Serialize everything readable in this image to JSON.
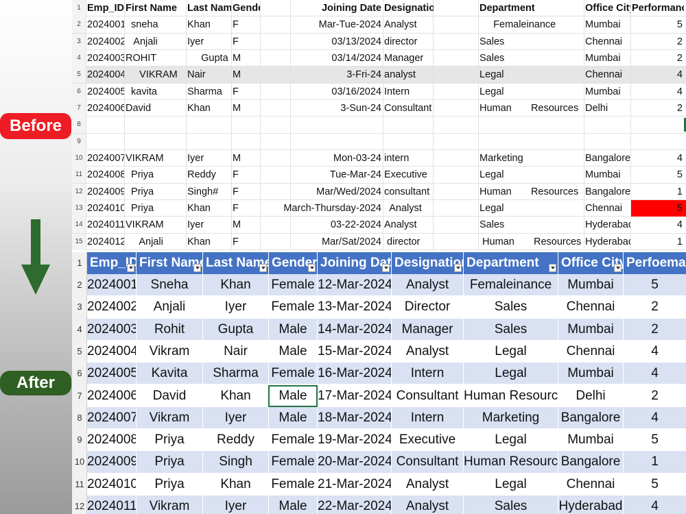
{
  "labels": {
    "before": "Before",
    "after": "After"
  },
  "colors": {
    "before_badge": "#ee1c25",
    "after_badge": "#2f5f22",
    "table_header": "#4472c4",
    "band": "#d9e1f2",
    "highlight_cell": "#ff0000"
  },
  "icons": {
    "arrow": "arrow-down-icon",
    "filter": "filter-dropdown-icon"
  },
  "before": {
    "headers": [
      "Emp_ID",
      "First Name",
      "Last Name",
      "Gender",
      "Joining Date",
      "Designation",
      "Department",
      "Office City",
      "Performance"
    ],
    "rows": [
      {
        "n": "2",
        "c": [
          "2024001",
          "  sneha",
          "Khan",
          "F",
          "Mar-Tue-2024",
          "Analyst",
          "     Femaleinance",
          "Mumbai",
          "5"
        ]
      },
      {
        "n": "3",
        "c": [
          "2024002",
          "   Anjali",
          "Iyer",
          "F",
          "03/13/2024",
          "director",
          "Sales",
          "Chennai",
          "2"
        ]
      },
      {
        "n": "4",
        "c": [
          "2024003",
          "ROHIT",
          "     Gupta",
          "M",
          "03/14/2024",
          "Manager",
          "Sales",
          "Mumbai",
          "2"
        ]
      },
      {
        "n": "5",
        "c": [
          "2024004",
          "     VIKRAM",
          "Nair",
          "M",
          "3-Fri-24",
          "analyst",
          "Legal",
          "Chennai",
          "4"
        ]
      },
      {
        "n": "6",
        "c": [
          "2024005",
          "  kavita",
          "Sharma",
          "F",
          "03/16/2024",
          "Intern",
          "Legal",
          "Mumbai",
          "4"
        ]
      },
      {
        "n": "7",
        "c": [
          "2024006",
          "David",
          "Khan",
          "M",
          "3-Sun-24",
          "Consultant",
          "Human       Resources",
          "Delhi",
          "2"
        ]
      },
      {
        "n": "8",
        "c": [
          "",
          "",
          "",
          "",
          "",
          "",
          "",
          "",
          ""
        ]
      },
      {
        "n": "9",
        "c": [
          "",
          "",
          "",
          "",
          "",
          "",
          "",
          "",
          ""
        ]
      },
      {
        "n": "10",
        "c": [
          "2024007",
          "VIKRAM",
          "Iyer",
          "M",
          "Mon-03-24",
          "intern",
          "Marketing",
          "Bangalore",
          "4"
        ]
      },
      {
        "n": "11",
        "c": [
          "2024008",
          "  Priya",
          "Reddy",
          "F",
          "Tue-Mar-24",
          "Executive",
          "Legal",
          "Mumbai",
          "5"
        ]
      },
      {
        "n": "12",
        "c": [
          "2024009",
          "  Priya",
          "Singh#",
          "F",
          "Mar/Wed/2024",
          "consultant",
          "Human       Resources",
          "Bangalore",
          "1"
        ]
      },
      {
        "n": "13",
        "c": [
          "2024010",
          "  Priya",
          "Khan",
          "F",
          "March-Thursday-2024",
          "  Analyst",
          "Legal",
          "Chennai",
          "5"
        ]
      },
      {
        "n": "14",
        "c": [
          "2024011",
          "VIKRAM",
          "Iyer",
          "M",
          "03-22-2024",
          "Analyst",
          "Sales",
          "Hyderabad",
          "4"
        ]
      },
      {
        "n": "15",
        "c": [
          "2024012",
          "     Anjali",
          "Khan",
          "F",
          "Mar/Sat/2024",
          " director",
          " Human       Resources",
          "Hyderabad",
          "1"
        ]
      }
    ]
  },
  "after": {
    "headers": [
      "Emp_ID",
      "First Name",
      "Last Name",
      "Gender",
      "Joining Date",
      "Designation",
      "Department",
      "Office City",
      "Perfoemance"
    ],
    "rows": [
      {
        "n": "2",
        "c": [
          "2024001",
          "Sneha",
          "Khan",
          "Female",
          "12-Mar-2024",
          "Analyst",
          "Femaleinance",
          "Mumbai",
          "5"
        ]
      },
      {
        "n": "3",
        "c": [
          "2024002",
          "Anjali",
          "Iyer",
          "Female",
          "13-Mar-2024",
          "Director",
          "Sales",
          "Chennai",
          "2"
        ]
      },
      {
        "n": "4",
        "c": [
          "2024003",
          "Rohit",
          "Gupta",
          "Male",
          "14-Mar-2024",
          "Manager",
          "Sales",
          "Mumbai",
          "2"
        ]
      },
      {
        "n": "5",
        "c": [
          "2024004",
          "Vikram",
          "Nair",
          "Male",
          "15-Mar-2024",
          "Analyst",
          "Legal",
          "Chennai",
          "4"
        ]
      },
      {
        "n": "6",
        "c": [
          "2024005",
          "Kavita",
          "Sharma",
          "Female",
          "16-Mar-2024",
          "Intern",
          "Legal",
          "Mumbai",
          "4"
        ]
      },
      {
        "n": "7",
        "c": [
          "2024006",
          "David",
          "Khan",
          "Male",
          "17-Mar-2024",
          "Consultant",
          "Human Resources",
          "Delhi",
          "2"
        ]
      },
      {
        "n": "8",
        "c": [
          "2024007",
          "Vikram",
          "Iyer",
          "Male",
          "18-Mar-2024",
          "Intern",
          "Marketing",
          "Bangalore",
          "4"
        ]
      },
      {
        "n": "9",
        "c": [
          "2024008",
          "Priya",
          "Reddy",
          "Female",
          "19-Mar-2024",
          "Executive",
          "Legal",
          "Mumbai",
          "5"
        ]
      },
      {
        "n": "10",
        "c": [
          "2024009",
          "Priya",
          "Singh",
          "Female",
          "20-Mar-2024",
          "Consultant",
          "Human Resources",
          "Bangalore",
          "1"
        ]
      },
      {
        "n": "11",
        "c": [
          "2024010",
          "Priya",
          "Khan",
          "Female",
          "21-Mar-2024",
          "Analyst",
          "Legal",
          "Chennai",
          "5"
        ]
      },
      {
        "n": "12",
        "c": [
          "2024011",
          "Vikram",
          "Iyer",
          "Male",
          "22-Mar-2024",
          "Analyst",
          "Sales",
          "Hyderabad",
          "4"
        ]
      }
    ]
  }
}
